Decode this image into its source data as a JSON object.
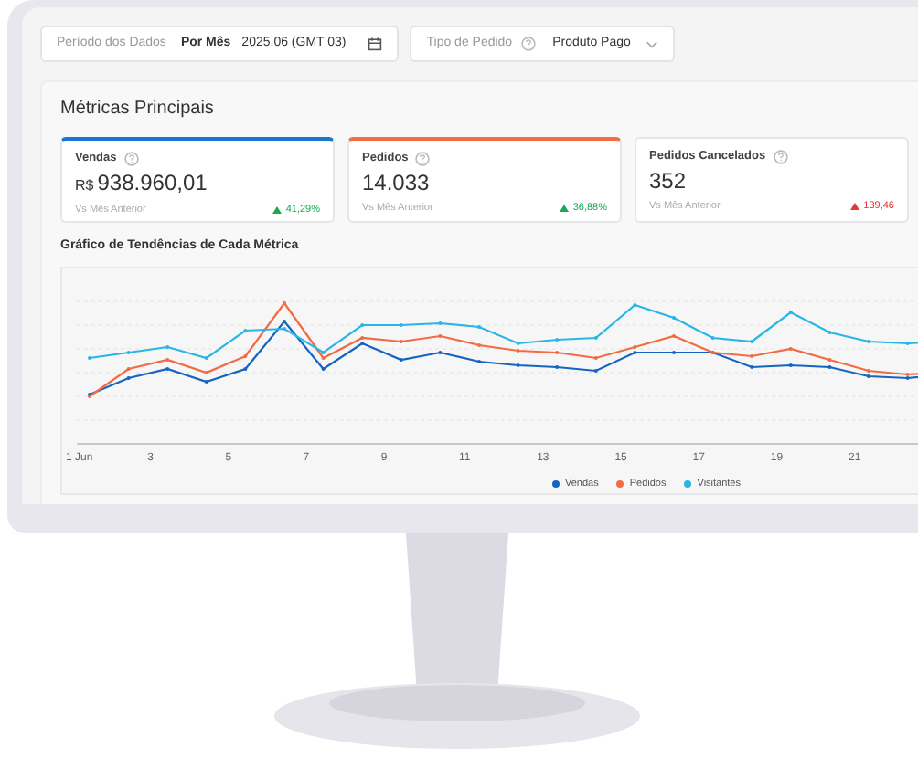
{
  "date_filter": {
    "label": "Período dos Dados",
    "mode": "Por Mês",
    "value": "2025.06 (GMT 03)"
  },
  "order_type_filter": {
    "label": "Tipo de Pedido",
    "value": "Produto Pago"
  },
  "metrics_title": "Métricas Principais",
  "metrics": [
    {
      "name": "Vendas",
      "currency": "R$",
      "value": "938.960,01",
      "comparison": "Vs Mês Anterior",
      "change": {
        "text": "41,29%",
        "color": "#1aaa55"
      },
      "color": "#1976d2"
    },
    {
      "name": "Pedidos",
      "value": "14.033",
      "comparison": "Vs Mês Anterior",
      "change": {
        "text": "36,88%",
        "color": "#1aaa55"
      },
      "color": "#f26b43"
    },
    {
      "name": "Pedidos Cancelados",
      "value": "352",
      "comparison": "Vs Mês Anterior",
      "change": {
        "text": "139,46",
        "color": "#e53935"
      }
    }
  ],
  "chart": {
    "title": "Gráfico de Tendências de Cada Métrica",
    "x_labels": [
      "1 Jun",
      "3",
      "5",
      "7",
      "9",
      "11",
      "13",
      "15",
      "17",
      "19",
      "21"
    ],
    "legend": [
      {
        "name": "Vendas",
        "color": "#1565c0"
      },
      {
        "name": "Pedidos",
        "color": "#f26b43"
      },
      {
        "name": "Visitantes",
        "color": "#29b6e6"
      }
    ]
  }
}
